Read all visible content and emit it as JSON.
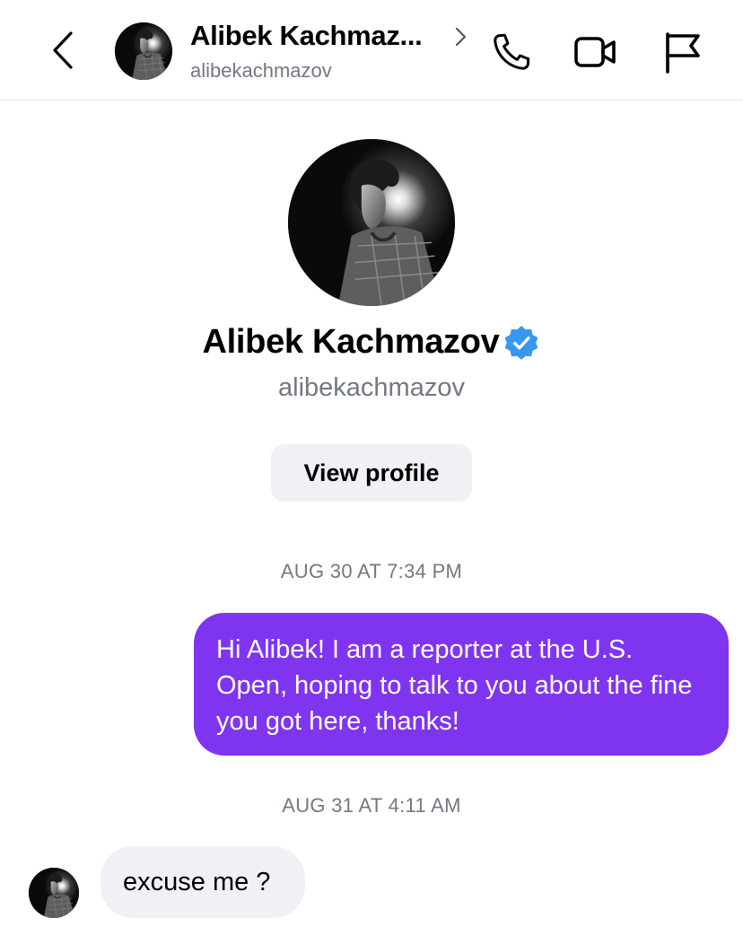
{
  "header": {
    "name": "Alibek Kachmaz...",
    "username": "alibekachmazov",
    "icons": [
      "back-arrow-icon",
      "chevron-right-icon",
      "phone-icon",
      "video-camera-icon",
      "flag-icon"
    ]
  },
  "profile": {
    "name": "Alibek Kachmazov",
    "username": "alibekachmazov",
    "verified": true,
    "view_profile_label": "View profile"
  },
  "messages": [
    {
      "timestamp": "AUG 30 AT 7:34 PM",
      "direction": "outgoing",
      "text": "Hi Alibek! I am a reporter at the U.S. Open, hoping to talk to you about the fine you got here, thanks!"
    },
    {
      "timestamp": "AUG 31 AT 4:11 AM",
      "direction": "incoming",
      "text": "excuse me ?"
    }
  ],
  "colors": {
    "outgoing_bubble": "#7f35f0",
    "incoming_bubble": "#eff1f4",
    "verified_badge": "#3897f0",
    "secondary_text": "#737880"
  }
}
